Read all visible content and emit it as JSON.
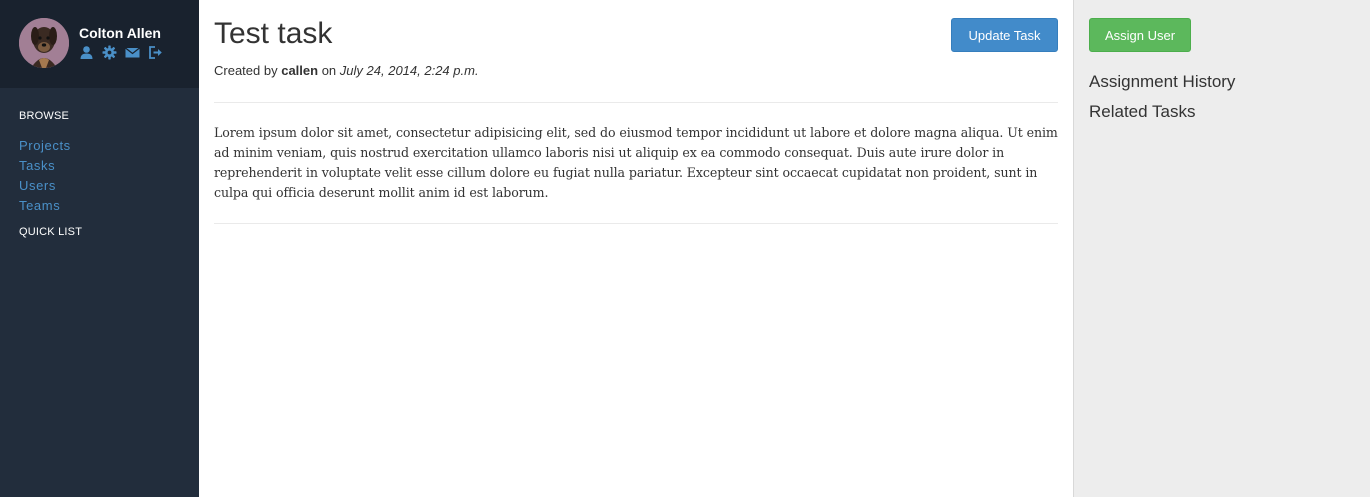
{
  "sidebar": {
    "user": {
      "name": "Colton Allen"
    },
    "profile_icons": [
      "user-icon",
      "gear-icon",
      "envelope-icon",
      "logout-icon"
    ],
    "browse_heading": "BROWSE",
    "nav": [
      {
        "label": "Projects"
      },
      {
        "label": "Tasks"
      },
      {
        "label": "Users"
      },
      {
        "label": "Teams"
      }
    ],
    "quick_list_heading": "QUICK LIST"
  },
  "task": {
    "title": "Test task",
    "created_by_prefix": "Created by",
    "author": "callen",
    "on_word": "on",
    "date": "July 24, 2014, 2:24 p.m.",
    "update_button": "Update Task",
    "description": "Lorem ipsum dolor sit amet, consectetur adipisicing elit, sed do eiusmod tempor incididunt ut labore et dolore magna aliqua. Ut enim ad minim veniam, quis nostrud exercitation ullamco laboris nisi ut aliquip ex ea commodo consequat. Duis aute irure dolor in reprehenderit in voluptate velit esse cillum dolore eu fugiat nulla pariatur. Excepteur sint occaecat cupidatat non proident, sunt in culpa qui officia deserunt mollit anim id est laborum."
  },
  "right_panel": {
    "assign_button": "Assign User",
    "assignment_history": "Assignment History",
    "related_tasks": "Related Tasks"
  },
  "colors": {
    "sidebar_bg": "#222d3c",
    "profile_bg": "#19222e",
    "link": "#4a90c8",
    "primary_button": "#428bca",
    "success_button": "#5cb85c",
    "right_panel_bg": "#ededed"
  }
}
